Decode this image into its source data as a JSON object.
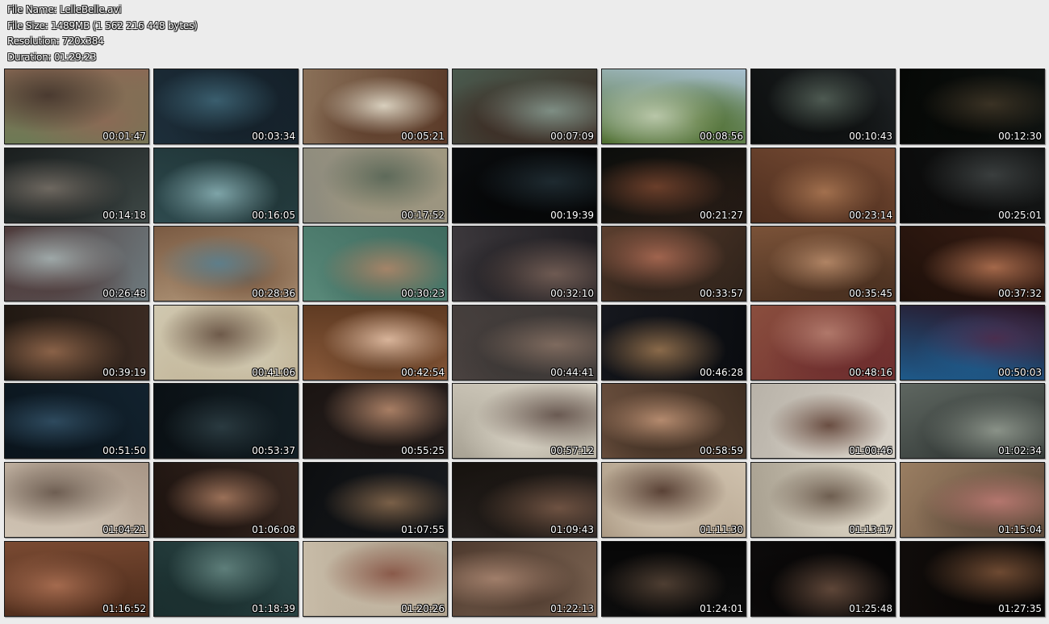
{
  "info": {
    "file_name": "File Name: LelleBelle.avi",
    "file_size": "File Size: 1489MB (1 562 216 448 bytes)",
    "resolution": "Resolution: 720x384",
    "duration": "Duration: 01:29:23"
  },
  "thumbnails": [
    {
      "time": "00:01:47",
      "colors": [
        "#6d7a55",
        "#4a3a30",
        "#8a6a55"
      ]
    },
    {
      "time": "00:03:34",
      "colors": [
        "#1d2e3a",
        "#3a5e6e",
        "#142029"
      ]
    },
    {
      "time": "00:05:21",
      "colors": [
        "#8a7058",
        "#d8cfbd",
        "#5a3a28"
      ]
    },
    {
      "time": "00:07:09",
      "colors": [
        "#4a5a4e",
        "#7e8e84",
        "#3b2a22"
      ]
    },
    {
      "time": "00:08:56",
      "colors": [
        "#a8c0d0",
        "#b8c6a8",
        "#4e6e2e"
      ]
    },
    {
      "time": "00:10:43",
      "colors": [
        "#1e2224",
        "#4e5a52",
        "#0c0e0e"
      ]
    },
    {
      "time": "00:12:30",
      "colors": [
        "#0e1210",
        "#3a3224",
        "#060806"
      ]
    },
    {
      "time": "00:14:18",
      "colors": [
        "#3e4846",
        "#6e6860",
        "#1a1e1e"
      ]
    },
    {
      "time": "00:16:05",
      "colors": [
        "#2e4a4e",
        "#7ea4a8",
        "#1e3234"
      ]
    },
    {
      "time": "00:17:52",
      "colors": [
        "#8c8a7e",
        "#5e6a5a",
        "#a09880"
      ]
    },
    {
      "time": "00:19:39",
      "colors": [
        "#0a0c0e",
        "#1e2a30",
        "#050607"
      ]
    },
    {
      "time": "00:21:27",
      "colors": [
        "#0c0e0c",
        "#6a3e2a",
        "#241a14"
      ]
    },
    {
      "time": "00:23:14",
      "colors": [
        "#7a4e36",
        "#a2704e",
        "#4e2e1e"
      ]
    },
    {
      "time": "00:25:01",
      "colors": [
        "#141616",
        "#3a3e3e",
        "#0a0a0a"
      ]
    },
    {
      "time": "00:26:48",
      "colors": [
        "#6e7a7e",
        "#9ea8a8",
        "#4e3a3a"
      ]
    },
    {
      "time": "00:28:36",
      "colors": [
        "#b89e80",
        "#5e7e8a",
        "#7a5a42"
      ]
    },
    {
      "time": "00:30:23",
      "colors": [
        "#5a8a7a",
        "#a48468",
        "#3e6a5e"
      ]
    },
    {
      "time": "00:32:10",
      "colors": [
        "#3e3a3e",
        "#6e5a52",
        "#1e1c20"
      ]
    },
    {
      "time": "00:33:57",
      "colors": [
        "#5a3e2e",
        "#a0644e",
        "#2e221a"
      ]
    },
    {
      "time": "00:35:45",
      "colors": [
        "#7a5238",
        "#b08464",
        "#4a3020"
      ]
    },
    {
      "time": "00:37:32",
      "colors": [
        "#3a1e14",
        "#a4684a",
        "#1e100a"
      ]
    },
    {
      "time": "00:39:19",
      "colors": [
        "#3a2a22",
        "#8a6248",
        "#201812"
      ]
    },
    {
      "time": "00:41:06",
      "colors": [
        "#b8a888",
        "#6e5a4a",
        "#d0c8b0"
      ]
    },
    {
      "time": "00:42:54",
      "colors": [
        "#8a5a3a",
        "#d8b49a",
        "#5e3a22"
      ]
    },
    {
      "time": "00:44:41",
      "colors": [
        "#4a4240",
        "#7e6a5e",
        "#3a3634"
      ]
    },
    {
      "time": "00:46:28",
      "colors": [
        "#16181e",
        "#8a6a4a",
        "#0a0c10"
      ]
    },
    {
      "time": "00:48:16",
      "colors": [
        "#8a4e3e",
        "#b0786a",
        "#6e2e2e"
      ]
    },
    {
      "time": "00:50:03",
      "colors": [
        "#2a1424",
        "#4a2e4e",
        "#1e5a8a"
      ]
    },
    {
      "time": "00:51:50",
      "colors": [
        "#12222e",
        "#2e4a5e",
        "#0a141c"
      ]
    },
    {
      "time": "00:53:37",
      "colors": [
        "#121e24",
        "#2a3a40",
        "#0a1014"
      ]
    },
    {
      "time": "00:55:25",
      "colors": [
        "#2a2220",
        "#a87e64",
        "#1a1412"
      ]
    },
    {
      "time": "00:57:12",
      "colors": [
        "#a8a294",
        "#6a5a52",
        "#d8d2c4"
      ]
    },
    {
      "time": "00:58:59",
      "colors": [
        "#6e5240",
        "#b48a6e",
        "#3e2e22"
      ]
    },
    {
      "time": "01:00:46",
      "colors": [
        "#b8b2a8",
        "#6a4e42",
        "#d8d2c8"
      ]
    },
    {
      "time": "01:02:34",
      "colors": [
        "#5e6660",
        "#8a9288",
        "#2e3432"
      ]
    },
    {
      "time": "01:04:21",
      "colors": [
        "#a89686",
        "#6e5e52",
        "#d0c4b4"
      ]
    },
    {
      "time": "01:06:08",
      "colors": [
        "#3a2a22",
        "#9a7058",
        "#1e1410"
      ]
    },
    {
      "time": "01:07:55",
      "colors": [
        "#1a1c20",
        "#7a6048",
        "#0c0e10"
      ]
    },
    {
      "time": "01:09:43",
      "colors": [
        "#2a2422",
        "#6e5242",
        "#16120e"
      ]
    },
    {
      "time": "01:11:30",
      "colors": [
        "#a89680",
        "#5a4236",
        "#d0c2ae"
      ]
    },
    {
      "time": "01:13:17",
      "colors": [
        "#a8a090",
        "#6e5e50",
        "#d8d0c0"
      ]
    },
    {
      "time": "01:15:04",
      "colors": [
        "#9a7e62",
        "#b4766e",
        "#5e4a3a"
      ]
    },
    {
      "time": "01:16:52",
      "colors": [
        "#7a4a32",
        "#a46a4e",
        "#4a2a1a"
      ]
    },
    {
      "time": "01:18:39",
      "colors": [
        "#2e4a4a",
        "#5e7e7a",
        "#1a2e2e"
      ]
    },
    {
      "time": "01:20:26",
      "colors": [
        "#a89a86",
        "#8a5a4a",
        "#c8bca8"
      ]
    },
    {
      "time": "01:22:13",
      "colors": [
        "#7e6654",
        "#a07e6a",
        "#4e3a2e"
      ]
    },
    {
      "time": "01:24:01",
      "colors": [
        "#0e0e0e",
        "#4e3e32",
        "#060606"
      ]
    },
    {
      "time": "01:25:48",
      "colors": [
        "#0e0c0c",
        "#5e4638",
        "#060505"
      ]
    },
    {
      "time": "01:27:35",
      "colors": [
        "#100c0a",
        "#6e4a32",
        "#080605"
      ]
    }
  ]
}
